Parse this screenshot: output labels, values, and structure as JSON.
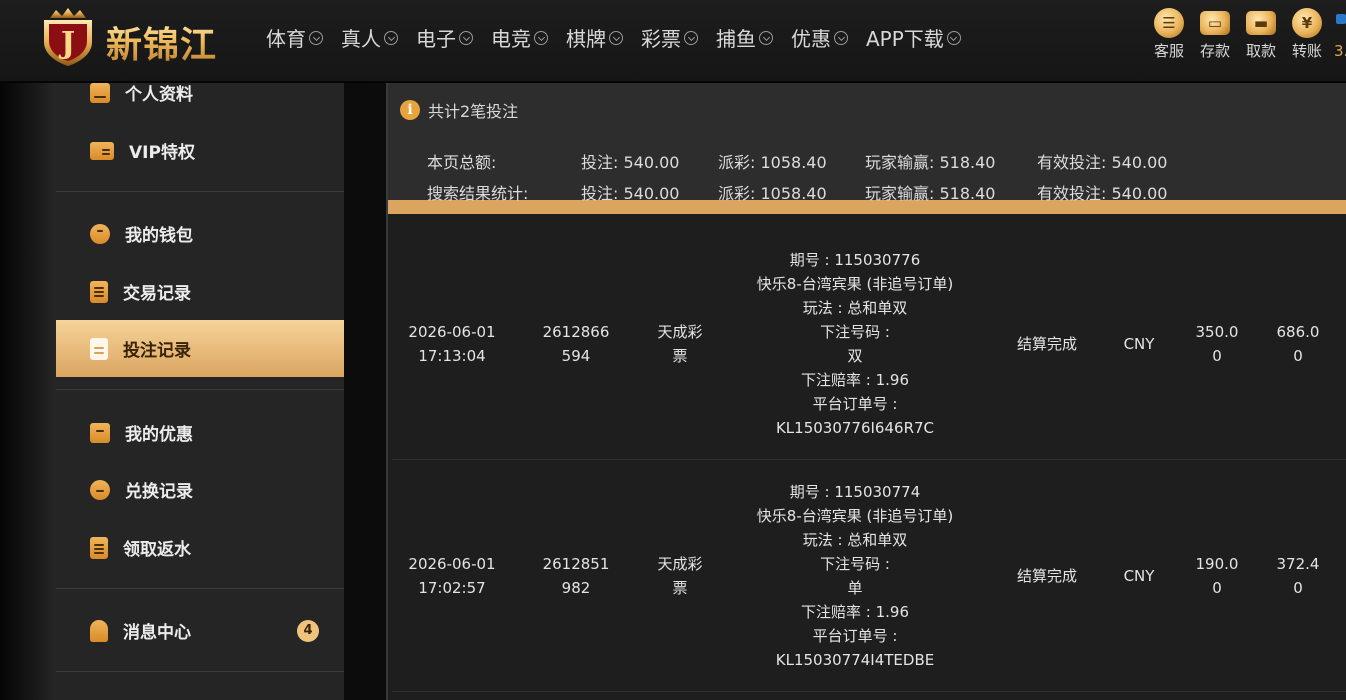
{
  "header": {
    "logo_text": "新锦江",
    "logo_letter": "J",
    "nav": [
      "体育",
      "真人",
      "电子",
      "电竞",
      "棋牌",
      "彩票",
      "捕鱼",
      "优惠",
      "APP下载"
    ],
    "tools": [
      {
        "label": "客服",
        "icon": "customer-service-icon"
      },
      {
        "label": "存款",
        "icon": "deposit-wallet-icon"
      },
      {
        "label": "取款",
        "icon": "withdraw-wallet-icon"
      },
      {
        "label": "转账",
        "icon": "transfer-coin-icon"
      }
    ],
    "tool_extra": "3."
  },
  "sidebar": {
    "items": [
      {
        "label": "个人资料",
        "icon": "profile-icon"
      },
      {
        "label": "VIP特权",
        "icon": "vip-card-icon"
      },
      {
        "label": "我的钱包",
        "icon": "piggy-bank-icon"
      },
      {
        "label": "交易记录",
        "icon": "transaction-list-icon"
      },
      {
        "label": "投注记录",
        "icon": "bet-record-icon",
        "active": true
      },
      {
        "label": "我的优惠",
        "icon": "promotion-bag-icon"
      },
      {
        "label": "兑换记录",
        "icon": "exchange-bag-icon"
      },
      {
        "label": "领取返水",
        "icon": "rebate-clipboard-icon"
      },
      {
        "label": "消息中心",
        "icon": "bell-icon",
        "badge": "4"
      }
    ]
  },
  "summary": {
    "info": "共计2笔投注",
    "rows": [
      {
        "label": "本页总额:",
        "bet": "投注:  540.00",
        "payout": "派彩:  1058.40",
        "winloss": "玩家输赢:  518.40",
        "valid": "有效投注:  540.00"
      },
      {
        "label": "搜索结果统计:",
        "bet": "投注:  540.00",
        "payout": "派彩:  1058.40",
        "winloss": "玩家输赢:  518.40",
        "valid": "有效投注:  540.00"
      }
    ]
  },
  "bets": [
    {
      "date": "2026-06-01\n17:13:04",
      "order_id": "2612866\n594",
      "provider": "天成彩\n票",
      "details": [
        "期号 : 115030776",
        "快乐8-台湾宾果 (非追号订单)",
        "玩法 : 总和单双",
        "下注号码 :",
        "双",
        "下注赔率 : 1.96",
        "平台订单号 :",
        "KL15030776I646R7C"
      ],
      "status": "结算完成",
      "currency": "CNY",
      "bet_amount": "350.0\n0",
      "payout": "686.0\n0"
    },
    {
      "date": "2026-06-01\n17:02:57",
      "order_id": "2612851\n982",
      "provider": "天成彩\n票",
      "details": [
        "期号 : 115030774",
        "快乐8-台湾宾果 (非追号订单)",
        "玩法 : 总和单双",
        "下注号码 :",
        "单",
        "下注赔率 : 1.96",
        "平台订单号 :",
        "KL15030774I4TEDBE"
      ],
      "status": "结算完成",
      "currency": "CNY",
      "bet_amount": "190.0\n0",
      "payout": "372.4\n0"
    }
  ],
  "colors": {
    "accent_gold": "#dba560",
    "icon_gold": "#e8a43c",
    "panel": "#252525",
    "header": "#1d1d1d"
  }
}
